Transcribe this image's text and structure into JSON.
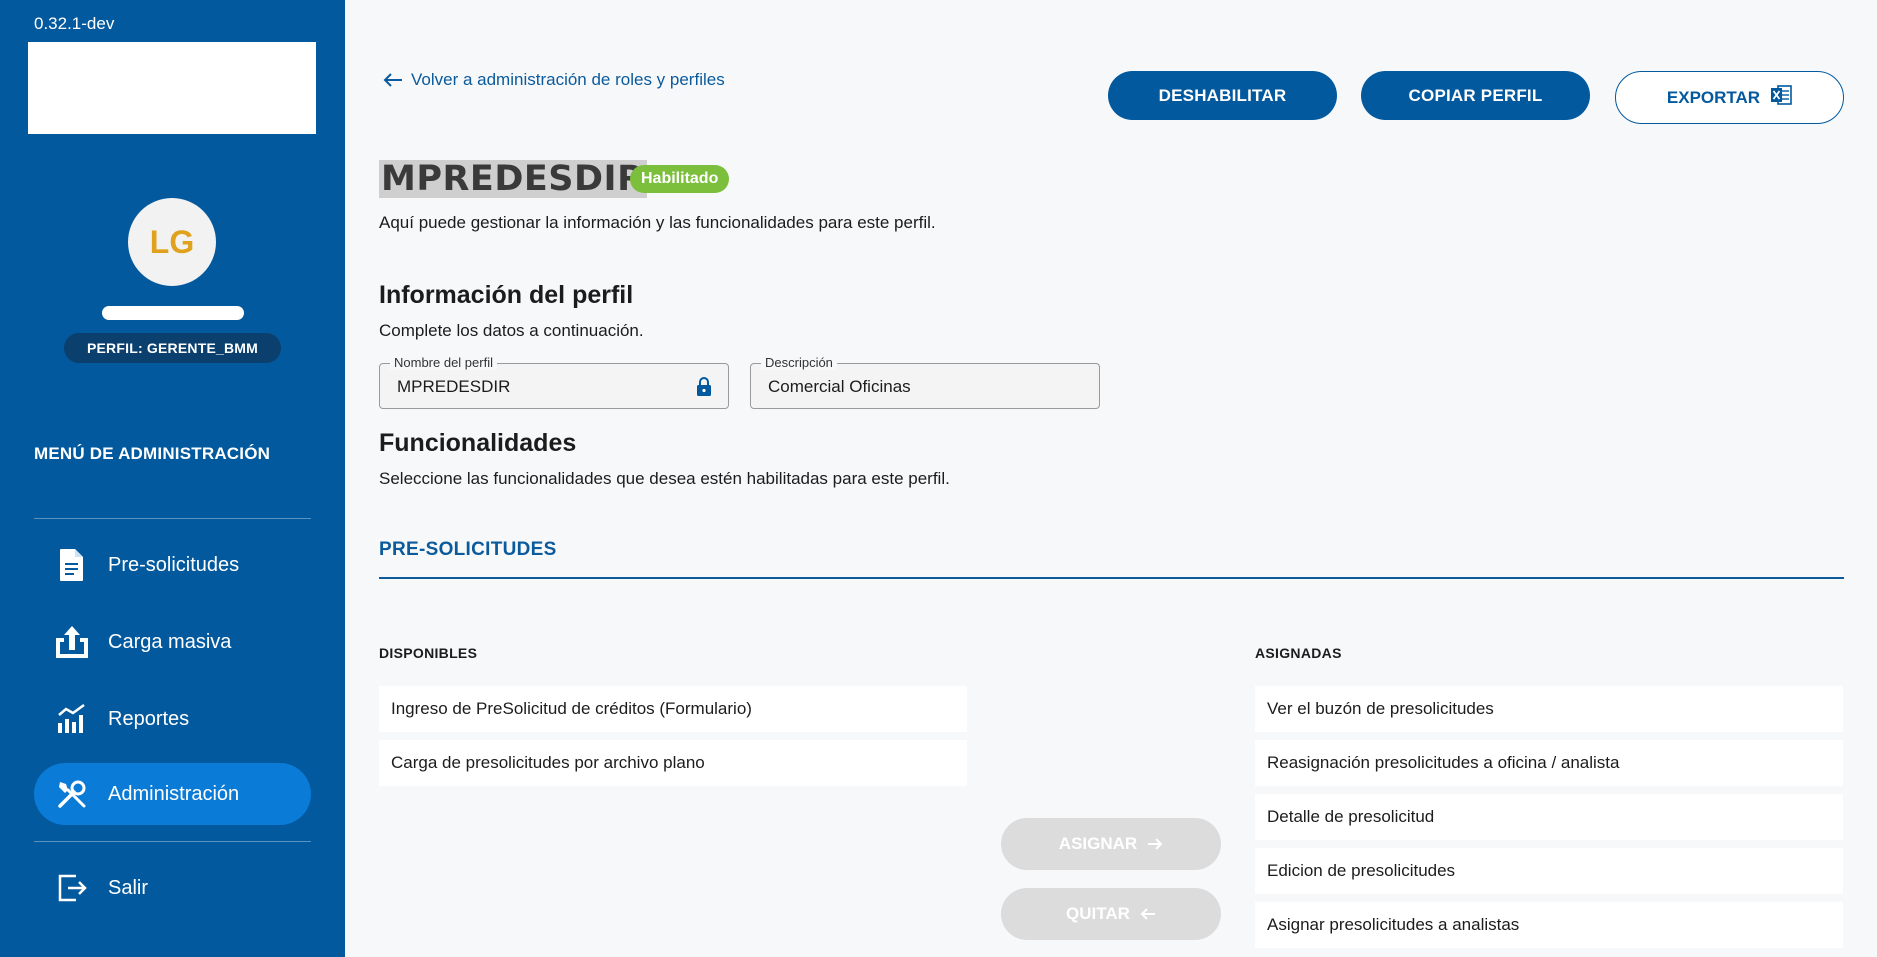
{
  "sidebar": {
    "version": "0.32.1-dev",
    "avatar_initials": "LG",
    "profile_badge": "PERFIL: GERENTE_BMM",
    "menu_title": "MENÚ DE ADMINISTRACIÓN",
    "items": [
      {
        "label": "Pre-solicitudes",
        "icon": "document-icon"
      },
      {
        "label": "Carga masiva",
        "icon": "upload-icon"
      },
      {
        "label": "Reportes",
        "icon": "chart-icon"
      },
      {
        "label": "Administración",
        "icon": "tools-icon",
        "active": true
      },
      {
        "label": "Salir",
        "icon": "logout-icon"
      }
    ]
  },
  "header": {
    "back_link": "Volver a administración de roles y perfiles",
    "disable_button": "DESHABILITAR",
    "copy_button": "COPIAR PERFIL",
    "export_button": "EXPORTAR"
  },
  "profile": {
    "name": "MPREDESDIR",
    "status": "Habilitado",
    "description_text": "Aquí puede gestionar la información y las funcionalidades para este perfil."
  },
  "info_section": {
    "title": "Información del perfil",
    "subtitle": "Complete los datos a continuación.",
    "name_label": "Nombre del perfil",
    "name_value": "MPREDESDIR",
    "desc_label": "Descripción",
    "desc_value": "Comercial Oficinas"
  },
  "func_section": {
    "title": "Funcionalidades",
    "subtitle": "Seleccione las funcionalidades que desea estén habilitadas para este perfil.",
    "tab": "PRE-SOLICITUDES",
    "available_header": "DISPONIBLES",
    "assigned_header": "ASIGNADAS",
    "available": [
      "Ingreso de PreSolicitud de créditos (Formulario)",
      "Carga de presolicitudes por archivo plano"
    ],
    "assigned": [
      "Ver el buzón de presolicitudes",
      "Reasignación presolicitudes a oficina / analista",
      "Detalle de presolicitud",
      "Edicion de presolicitudes",
      "Asignar presolicitudes a analistas"
    ],
    "assign_button": "ASIGNAR",
    "remove_button": "QUITAR"
  },
  "colors": {
    "sidebar": "#03599e",
    "active_item": "#0a7bd6",
    "status": "#7cbf3c",
    "accent": "#0b5a9c"
  }
}
